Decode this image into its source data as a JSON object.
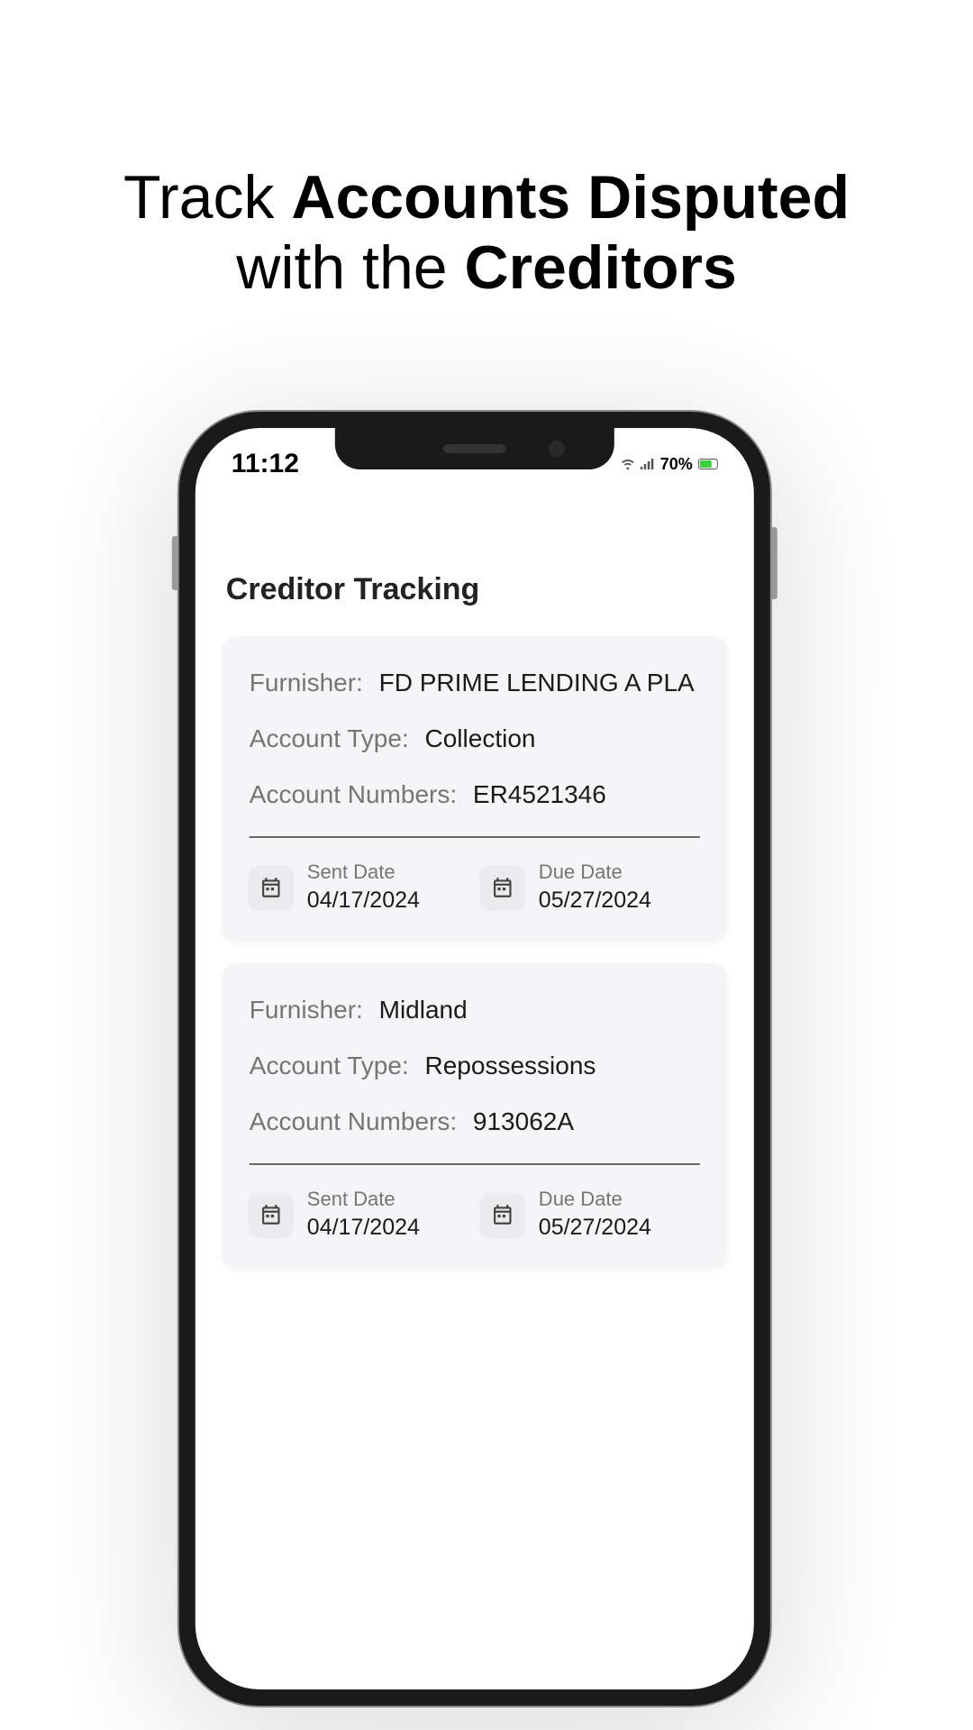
{
  "headline": {
    "part1": "Track ",
    "part2": "Accounts Disputed",
    "part3": "with the ",
    "part4": "Creditors"
  },
  "status": {
    "time": "11:12",
    "battery": "70%"
  },
  "page_title": "Creditor Tracking",
  "labels": {
    "furnisher": "Furnisher:",
    "account_type": "Account Type:",
    "account_numbers": "Account Numbers:",
    "sent_date": "Sent Date",
    "due_date": "Due Date"
  },
  "accounts": [
    {
      "furnisher": "FD PRIME LENDING A PLA",
      "account_type": "Collection",
      "account_numbers": "ER4521346",
      "sent_date": "04/17/2024",
      "due_date": "05/27/2024"
    },
    {
      "furnisher": "Midland",
      "account_type": "Repossessions",
      "account_numbers": "913062A",
      "sent_date": "04/17/2024",
      "due_date": "05/27/2024"
    }
  ]
}
